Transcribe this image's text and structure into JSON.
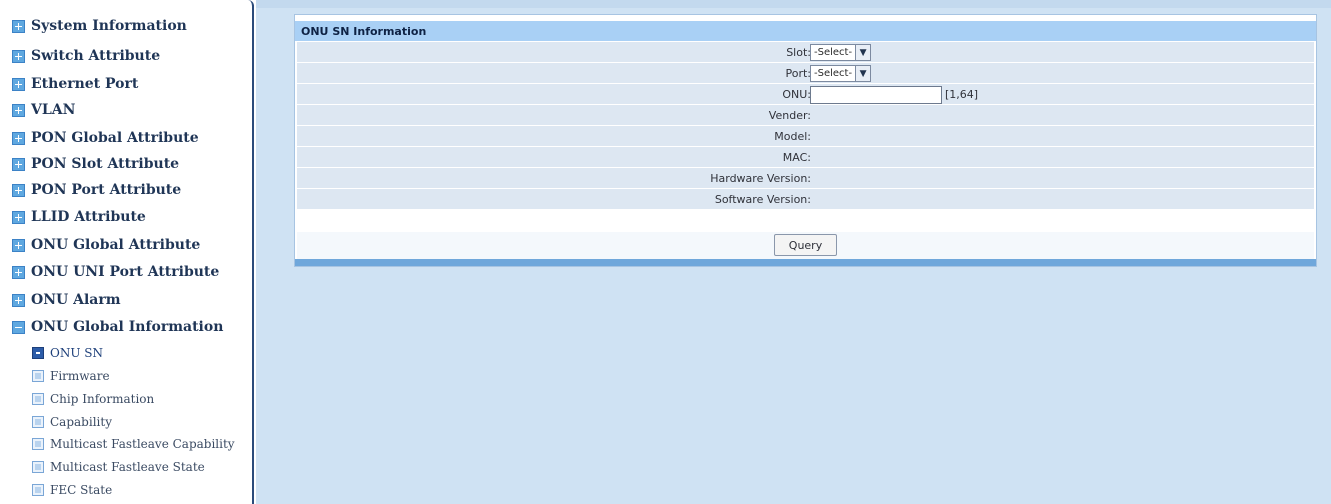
{
  "sidebar": {
    "items": [
      {
        "label": "System Information",
        "expanded": false
      },
      {
        "label": "Switch Attribute",
        "expanded": false
      },
      {
        "label": "Ethernet Port",
        "expanded": false
      },
      {
        "label": "VLAN",
        "expanded": false
      },
      {
        "label": "PON Global Attribute",
        "expanded": false
      },
      {
        "label": "PON Slot Attribute",
        "expanded": false
      },
      {
        "label": "PON Port Attribute",
        "expanded": false
      },
      {
        "label": "LLID Attribute",
        "expanded": false
      },
      {
        "label": "ONU Global Attribute",
        "expanded": false
      },
      {
        "label": "ONU UNI Port Attribute",
        "expanded": false
      },
      {
        "label": "ONU Alarm",
        "expanded": false
      },
      {
        "label": "ONU Global Information",
        "expanded": true
      }
    ],
    "subitems": [
      {
        "label": "ONU SN",
        "active": true
      },
      {
        "label": "Firmware",
        "active": false
      },
      {
        "label": "Chip Information",
        "active": false
      },
      {
        "label": "Capability",
        "active": false
      },
      {
        "label": "Multicast Fastleave Capability",
        "active": false
      },
      {
        "label": "Multicast Fastleave State",
        "active": false
      },
      {
        "label": "FEC State",
        "active": false
      }
    ]
  },
  "panel": {
    "title": "ONU SN Information",
    "fields": {
      "slot": {
        "label": "Slot:",
        "selected": "-Select-"
      },
      "port": {
        "label": "Port:",
        "selected": "-Select-"
      },
      "onu": {
        "label": "ONU:",
        "value": "",
        "range": "[1,64]"
      },
      "vender": {
        "label": "Vender:",
        "value": ""
      },
      "model": {
        "label": "Model:",
        "value": ""
      },
      "mac": {
        "label": "MAC:",
        "value": ""
      },
      "hardware_version": {
        "label": "Hardware Version:",
        "value": ""
      },
      "software_version": {
        "label": "Software Version:",
        "value": ""
      }
    },
    "query_label": "Query"
  },
  "colors": {
    "main_bg": "#cfe2f3",
    "panel_header": "#a9d0f5",
    "row_bg": "#dde7f2",
    "sidebar_text": "#1f3556"
  }
}
